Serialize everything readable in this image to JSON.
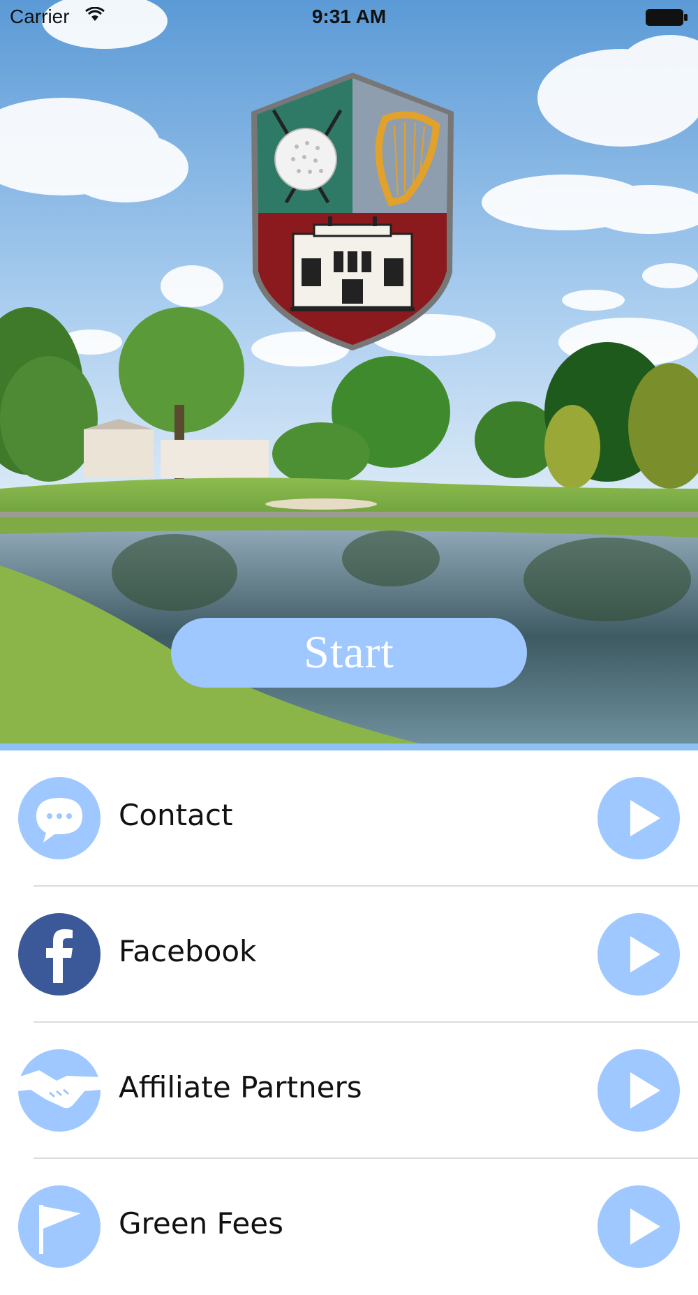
{
  "status_bar": {
    "carrier": "Carrier",
    "time": "9:31 AM"
  },
  "hero": {
    "start_label": "Start"
  },
  "menu": {
    "items": [
      {
        "label": "Contact",
        "icon": "chat-bubble-icon"
      },
      {
        "label": "Facebook",
        "icon": "facebook-icon"
      },
      {
        "label": "Affiliate Partners",
        "icon": "handshake-icon"
      },
      {
        "label": "Green Fees",
        "icon": "flag-icon"
      }
    ]
  },
  "colors": {
    "accent": "#9ec8ff",
    "divider": "#8ec0f5",
    "facebook": "#3b5998",
    "crest_green": "#2e7d6a",
    "crest_red": "#8b1a1f"
  }
}
